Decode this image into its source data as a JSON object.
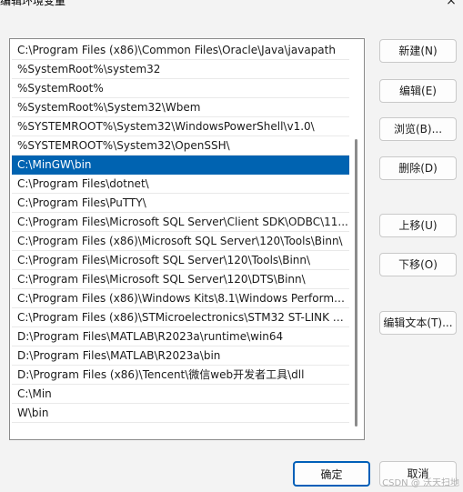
{
  "window": {
    "title": "编辑环境变量",
    "close_glyph": "×"
  },
  "paths": [
    "C:\\Program Files (x86)\\Common Files\\Oracle\\Java\\javapath",
    "%SystemRoot%\\system32",
    "%SystemRoot%",
    "%SystemRoot%\\System32\\Wbem",
    "%SYSTEMROOT%\\System32\\WindowsPowerShell\\v1.0\\",
    "%SYSTEMROOT%\\System32\\OpenSSH\\",
    "C:\\MinGW\\bin",
    "C:\\Program Files\\dotnet\\",
    "C:\\Program Files\\PuTTY\\",
    "C:\\Program Files\\Microsoft SQL Server\\Client SDK\\ODBC\\11...",
    "C:\\Program Files (x86)\\Microsoft SQL Server\\120\\Tools\\Binn\\",
    "C:\\Program Files\\Microsoft SQL Server\\120\\Tools\\Binn\\",
    "C:\\Program Files\\Microsoft SQL Server\\120\\DTS\\Binn\\",
    "C:\\Program Files (x86)\\Windows Kits\\8.1\\Windows Performa...",
    "C:\\Program Files (x86)\\STMicroelectronics\\STM32 ST-LINK U...",
    "D:\\Program Files\\MATLAB\\R2023a\\runtime\\win64",
    "D:\\Program Files\\MATLAB\\R2023a\\bin",
    "D:\\Program Files (x86)\\Tencent\\微信web开发者工具\\dll",
    "C:\\Min",
    "W\\bin"
  ],
  "selected_index": 6,
  "buttons": {
    "new": "新建(N)",
    "edit": "编辑(E)",
    "browse": "浏览(B)...",
    "delete": "删除(D)",
    "move_up": "上移(U)",
    "move_down": "下移(O)",
    "edit_text": "编辑文本(T)...",
    "ok": "确定",
    "cancel": "取消"
  },
  "watermark": "CSDN @ 沃天扫地",
  "colors": {
    "selection": "#0063b1",
    "ok_border": "#005fb8"
  }
}
